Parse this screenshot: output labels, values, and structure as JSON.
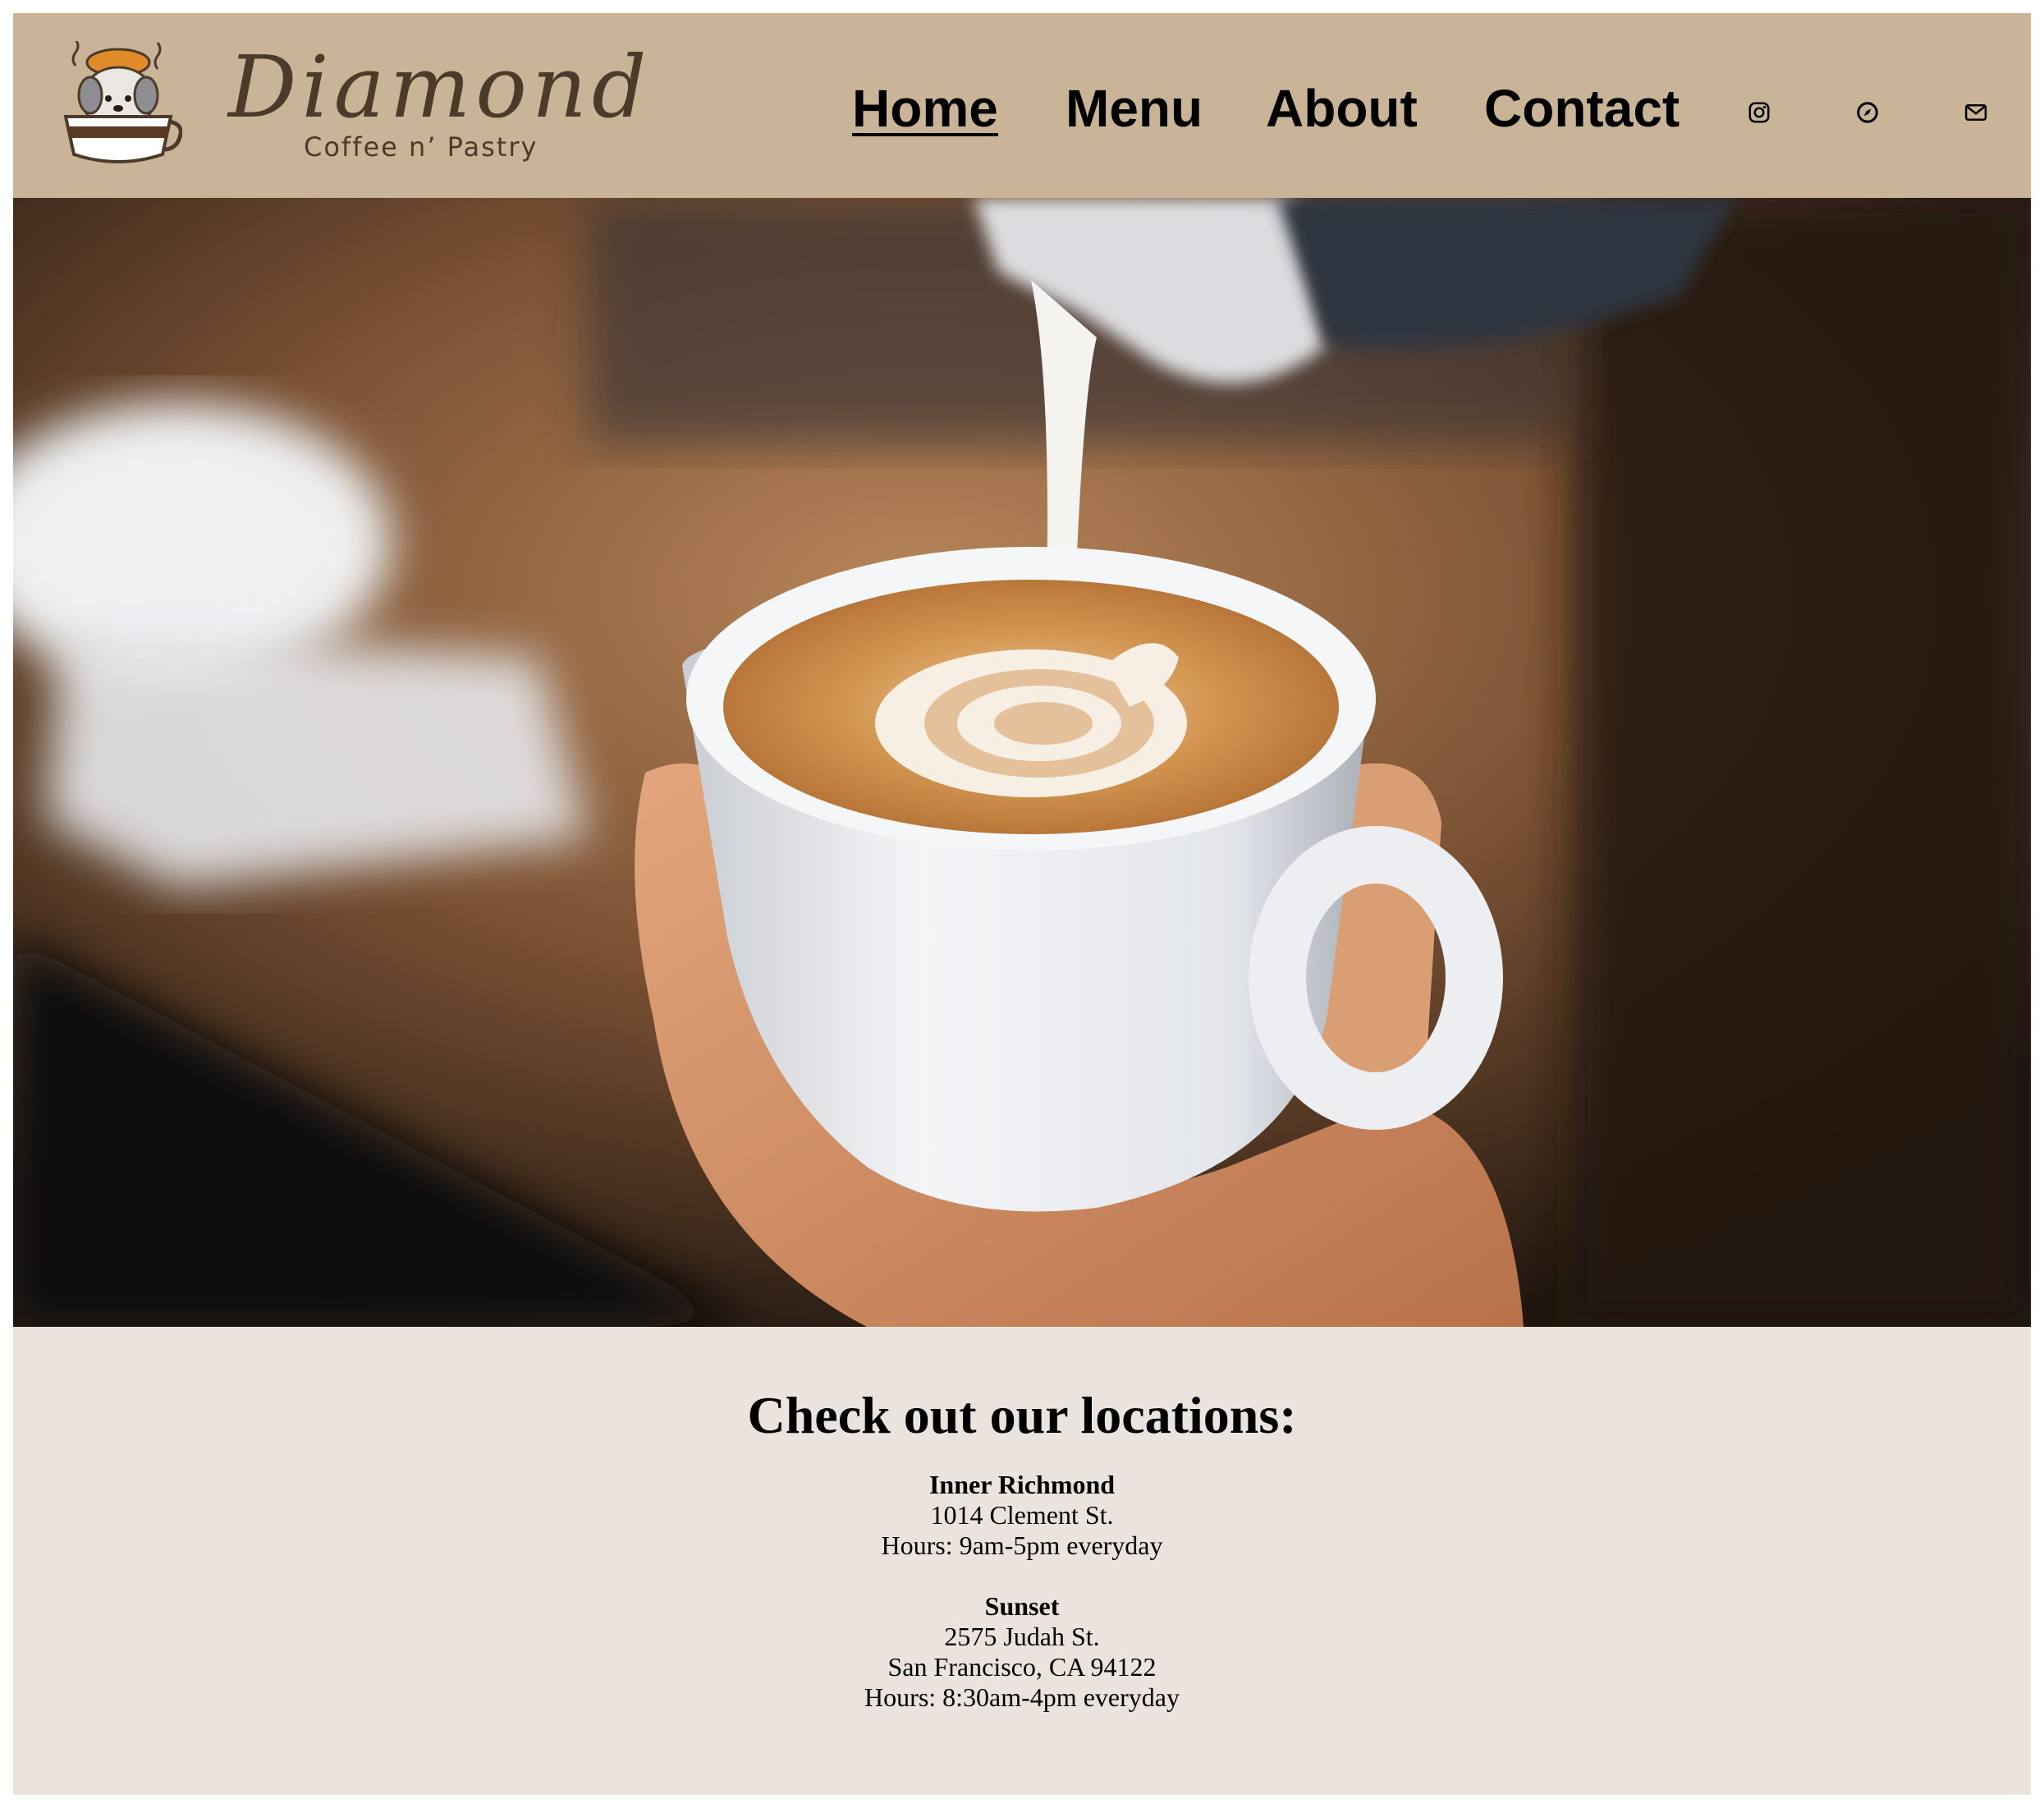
{
  "brand": {
    "name": "Diamond",
    "tagline": "Coffee n’ Pastry",
    "colors": {
      "header_bg": "#cab497",
      "text": "#4c3a2a",
      "page_bg": "#ebe4de"
    }
  },
  "nav": {
    "items": [
      {
        "label": "Home",
        "active": true
      },
      {
        "label": "Menu",
        "active": false
      },
      {
        "label": "About",
        "active": false
      },
      {
        "label": "Contact",
        "active": false
      }
    ],
    "social": [
      "instagram-icon",
      "compass-icon",
      "mail-icon"
    ]
  },
  "hero": {
    "image": "latte-art-pour-photo"
  },
  "locations": {
    "heading": "Check out our locations:",
    "list": [
      {
        "name": "Inner Richmond",
        "address": "1014 Clement St.",
        "hours": "Hours: 9am-5pm everyday"
      },
      {
        "name": "Sunset",
        "address": "2575 Judah St.",
        "city": "San Francisco, CA 94122",
        "hours": "Hours: 8:30am-4pm everyday"
      }
    ]
  }
}
